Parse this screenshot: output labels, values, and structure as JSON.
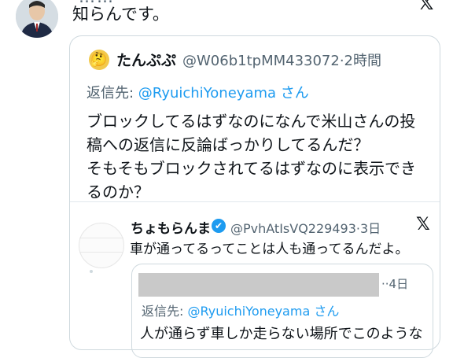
{
  "top_tweet": {
    "text_line": "知らんです。",
    "cut_line": "……",
    "x_logo": "𝕏"
  },
  "quote1": {
    "avatar_emoji": "🤔",
    "name": "たんぷぷ",
    "handle_time": "@W06b1tpMM433072·2時間",
    "reply_label": "返信先: ",
    "reply_target": "@RyuichiYoneyama さん",
    "body_lines": [
      "ブロックしてるはずなのになんで米山さんの投",
      "稿への返信に反論ばっかりしてるんだ？",
      "そもそもブロックされてるはずなのに表示でき",
      "るのか？"
    ]
  },
  "quote2": {
    "name": "ちょもらんま",
    "verified_glyph": "✔",
    "handle_time": "@PvhAtIsVQ229493·3日",
    "x_logo": "𝕏",
    "body": "車が通ってるってことは人も通ってるんだよ。"
  },
  "quote3": {
    "time": "··4日",
    "reply_label": "返信先: ",
    "reply_target": "@RyuichiYoneyama さん",
    "body": "人が通らず車しか走らない場所でこのような"
  }
}
